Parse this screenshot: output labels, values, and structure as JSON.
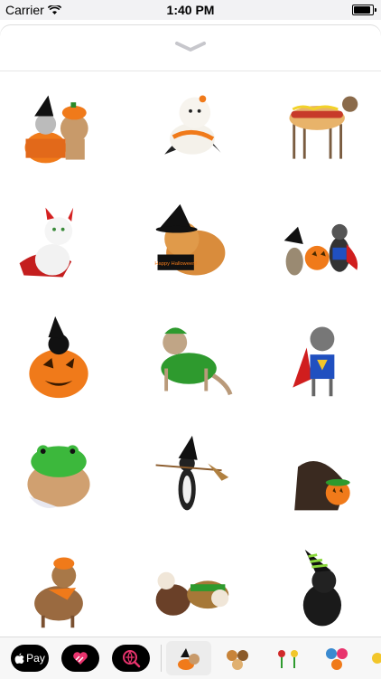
{
  "status": {
    "carrier": "Carrier",
    "time": "1:40 PM"
  },
  "stickers": [
    {
      "label": "cat-and-dog-in-pumpkin-costume"
    },
    {
      "label": "puppy-in-witch-cape"
    },
    {
      "label": "dog-in-hotdog-costume"
    },
    {
      "label": "kitten-in-devil-costume"
    },
    {
      "label": "pomeranian-with-witch-hat",
      "sign": "Happy Halloween!"
    },
    {
      "label": "cat-and-dog-with-jack-o-lantern"
    },
    {
      "label": "cat-in-pumpkin"
    },
    {
      "label": "cat-in-dinosaur-costume"
    },
    {
      "label": "dog-in-superhero-costume"
    },
    {
      "label": "guinea-pig-in-frog-costume"
    },
    {
      "label": "cat-with-witch-broom"
    },
    {
      "label": "dog-with-pumpkin-toy"
    },
    {
      "label": "dog-in-pumpkin-hat"
    },
    {
      "label": "bulldogs-in-costumes"
    },
    {
      "label": "black-cat-with-witch-hat"
    }
  ],
  "tray": {
    "apple_pay_label": "Pay"
  },
  "colors": {
    "pumpkin": "#f07a1a",
    "accent_pink": "#e8336d",
    "tray_bg": "#f7f7f7"
  }
}
